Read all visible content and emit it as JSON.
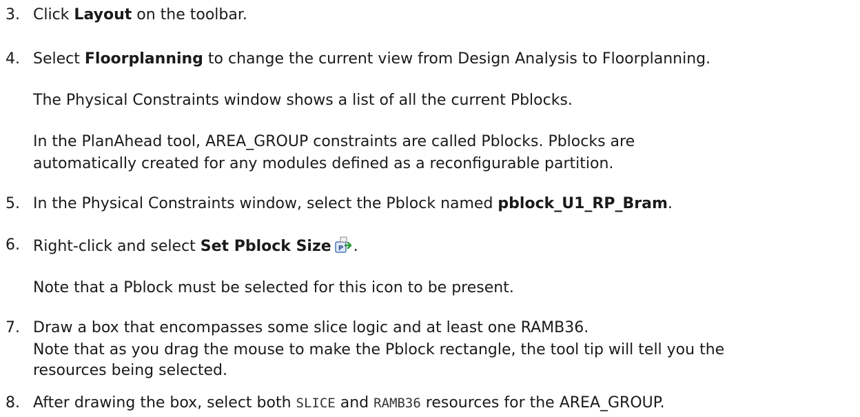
{
  "steps": [
    {
      "num": "3.",
      "pre": "Click ",
      "bold": "Layout",
      "post": " on the toolbar."
    },
    {
      "num": "4.",
      "pre": "Select ",
      "bold": "Floorplanning",
      "post": " to change the current view from Design Analysis to Floorplanning."
    },
    {
      "num": "5.",
      "pre": "In the Physical Constraints window, select the Pblock named ",
      "bold": "pblock_U1_RP_Bram",
      "post": "."
    },
    {
      "num": "6.",
      "pre": "Right-click and select ",
      "bold": "Set Pblock Size",
      "post": "."
    },
    {
      "num": "7.",
      "line1": "Draw a box that encompasses some slice logic and at least one RAMB36.",
      "line2": "Note that as you drag the mouse to make the Pblock rectangle, the tool tip will tell you the",
      "line3": "resources being selected."
    },
    {
      "num": "8.",
      "pre": "After drawing the box, select both ",
      "code1": "SLICE",
      "mid": " and ",
      "code2": "RAMB36",
      "post": " resources for the AREA_GROUP."
    }
  ],
  "notes": {
    "step4_a": "The Physical Constraints window shows a list of all the current Pblocks.",
    "step4_b1": "In the PlanAhead tool, AREA_GROUP constraints are called Pblocks. Pblocks are",
    "step4_b2": "automatically created for any modules defined as a reconfigurable partition.",
    "step6_a": "Note that a Pblock must be selected for this icon to be present."
  },
  "icons": {
    "set_pblock_size": "set-pblock-size-icon"
  }
}
